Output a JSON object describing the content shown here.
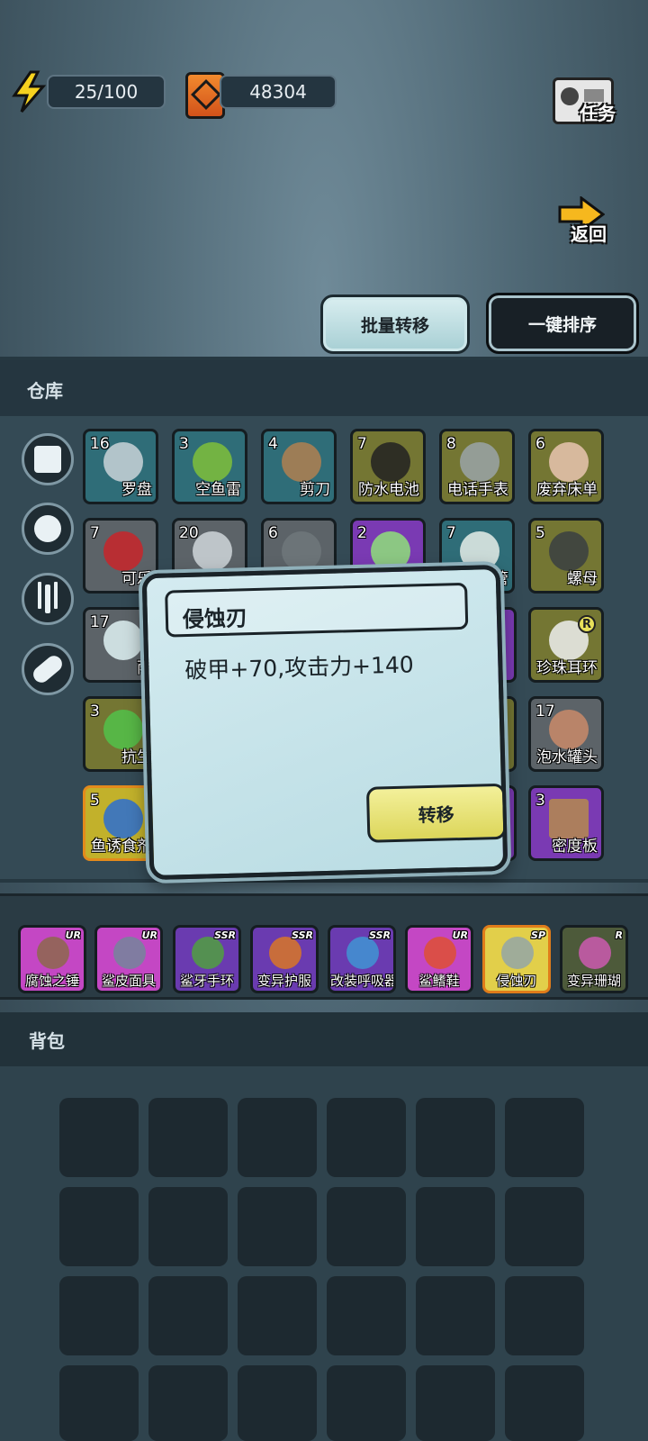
{
  "resources": {
    "energy": "25/100",
    "fuel": "48304"
  },
  "top_buttons": {
    "mission": "任务",
    "back": "返回"
  },
  "actions": {
    "batch_transfer": "批量转移",
    "one_key_sort": "一键排序"
  },
  "warehouse": {
    "title": "仓库",
    "filters": [
      "cube-icon",
      "can-icon",
      "fork-icon",
      "pill-icon"
    ],
    "items": [
      {
        "count": "16",
        "name": "罗盘",
        "quality": "teal"
      },
      {
        "count": "3",
        "name": "空鱼雷",
        "quality": "teal"
      },
      {
        "count": "4",
        "name": "剪刀",
        "quality": "teal"
      },
      {
        "count": "7",
        "name": "防水电池",
        "quality": "olive"
      },
      {
        "count": "8",
        "name": "电话手表",
        "quality": "olive"
      },
      {
        "count": "6",
        "name": "废弃床单",
        "quality": "olive"
      },
      {
        "count": "7",
        "name": "可乐",
        "quality": "gray"
      },
      {
        "count": "20",
        "name": "",
        "quality": "gray"
      },
      {
        "count": "6",
        "name": "",
        "quality": "gray"
      },
      {
        "count": "2",
        "name": "",
        "quality": "purple"
      },
      {
        "count": "7",
        "name": "管",
        "quality": "teal"
      },
      {
        "count": "5",
        "name": "螺母",
        "quality": "olive"
      },
      {
        "count": "17",
        "name": "雨",
        "quality": "gray"
      },
      {
        "count": "",
        "name": "珍珠耳环",
        "quality": "olive",
        "badge": "R"
      },
      {
        "count": "3",
        "name": "抗生",
        "quality": "olive"
      },
      {
        "count": "17",
        "name": "泡水罐头",
        "quality": "gray"
      },
      {
        "count": "5",
        "name": "鱼诱食剂",
        "quality": "yellow"
      },
      {
        "count": "3",
        "name": "密度板",
        "quality": "purple"
      }
    ]
  },
  "popup": {
    "title": "侵蚀刃",
    "description": "破甲+70,攻击力+140",
    "transfer_button": "转移"
  },
  "equipment": [
    {
      "name": "腐蚀之锤",
      "tier": "UR"
    },
    {
      "name": "鲨皮面具",
      "tier": "UR"
    },
    {
      "name": "鲨牙手环",
      "tier": "SSR"
    },
    {
      "name": "变异护服",
      "tier": "SSR"
    },
    {
      "name": "改装呼吸器",
      "tier": "SSR"
    },
    {
      "name": "鲨鳍鞋",
      "tier": "UR"
    },
    {
      "name": "侵蚀刃",
      "tier": "SP"
    },
    {
      "name": "变异珊瑚",
      "tier": "R"
    }
  ],
  "backpack": {
    "title": "背包"
  },
  "colors": {
    "background": "#4d6673",
    "panel": "#344a55",
    "popup": "#c6e3e9",
    "button_yellow": "#e6e070"
  }
}
